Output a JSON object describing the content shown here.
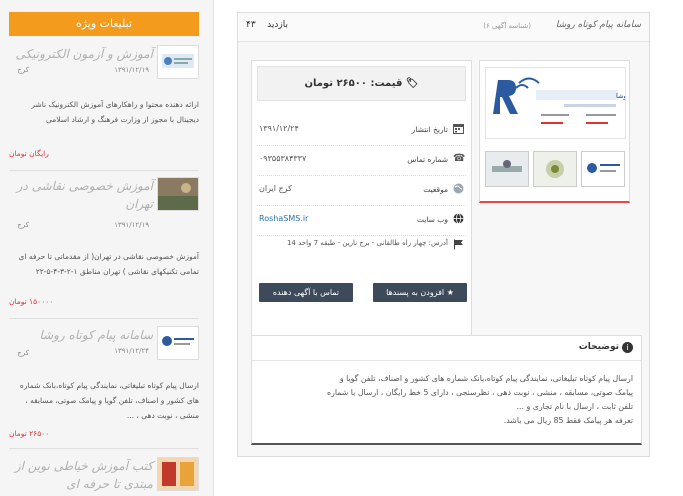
{
  "sidebar": {
    "header": "تبلیغات ویژه",
    "items": [
      {
        "title": "آموزش و آزمون الکترونیکی",
        "city": "کرج",
        "date": "۱۳۹۱/۱۲/۱۹",
        "desc": "ارائه دهنده محتوا و راهکارهای آموزش الکترونیک ناشر دیجیتال با مجوز از وزارت فرهنگ و ارشاد اسلامی",
        "price": "رایگان تومان"
      },
      {
        "title": "آموزش خصوصی نقاشی در تهران",
        "city": "کرج",
        "date": "۱۳۹۱/۱۲/۱۹",
        "desc": "آموزش خصوصی نقاشی در تهران( از مقدماتی تا حرفه ای تمامی تکنیکهای نقاشی ) تهران مناطق ۱-۲-۳-۴-۵-۲۲",
        "price": "۱۵۰۰۰۰ تومان"
      },
      {
        "title": "سامانه پیام کوتاه روشا",
        "city": "کرج",
        "date": "۱۳۹۱/۱۲/۲۴",
        "desc": "ارسال پیام کوتاه تبلیغاتی، نمایندگی پیام کوتاه،بانک شماره های کشور و اصناف، تلفن گویا و پیامک صوتی، مسابقه ، منشی ، نوبت دهی ، ...",
        "price": "۲۶۵۰۰ تومان"
      },
      {
        "title": "کتب آموزش خیاطی نوین از مبتدی تا حرفه ای"
      }
    ]
  },
  "ad": {
    "title": "سامانه پیام کوتاه روشا",
    "code": "(شناسه آگهی ۶)",
    "views_label": "بازدید",
    "views": "۴۳",
    "price_label": "قیمت:",
    "price_value": "۲۶۵۰۰ تومان",
    "fields": [
      {
        "label": "تاریخ انتشار",
        "value": "۱۳۹۱/۱۲/۲۴",
        "icon": "calendar-icon"
      },
      {
        "label": "شماره تماس",
        "value": "۰۹۳۵۵۳۸۴۳۳۷",
        "icon": "phone-icon"
      },
      {
        "label": "موقعیت",
        "value": "کرج ایران",
        "icon": "globe-icon"
      },
      {
        "label": "وب سایت",
        "value": "RoshaSMS.ir",
        "icon": "globe-dark-icon"
      }
    ],
    "address_label": "آدرس:",
    "address": "چهار راه طالقانی - برج نارین - طبقه 7 واحد 14",
    "contact_button": "تماس با آگهی دهنده",
    "favorite_button": "افزودن به پسندها",
    "gallery_logo": "سامانه پیام کوتاه روشا",
    "description_title": "توضیحات",
    "description_lines": [
      "ارسال پیام کوتاه تبلیغاتی، نمایندگی پیام کوتاه،بانک شماره های کشور و اصناف، تلفن گویا و",
      "پیامک صوتی، مسابقه ، منشی ، نوبت دهی ، نظرسنجی ، دارای 5 خط رایگان ، ارسال با شماره",
      "تلفن ثابت ، ارسال با نام تجاری و ...",
      "تعرفه هر پیامک فقط 85 ریال می باشد."
    ]
  },
  "colors": {
    "accent": "#f39b1c",
    "danger": "#e44444",
    "button": "#3c4a5a"
  }
}
